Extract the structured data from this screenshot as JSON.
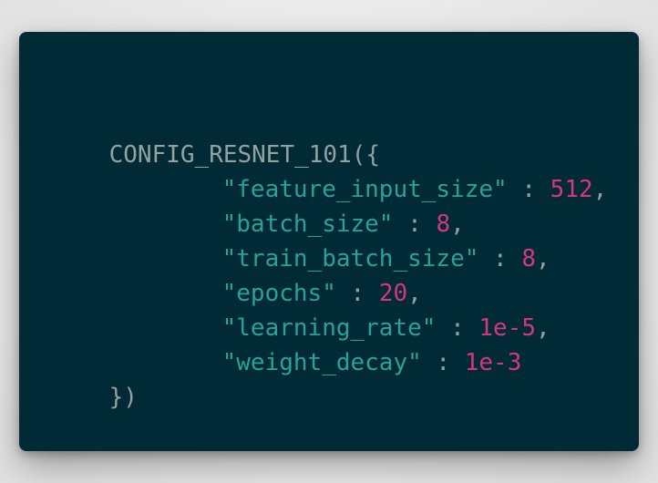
{
  "code": {
    "open_line": "CONFIG_RESNET_101({",
    "separator": " : ",
    "comma": ",",
    "close_line": "})",
    "entries": [
      {
        "key": "\"feature_input_size\"",
        "value": "512"
      },
      {
        "key": "\"batch_size\"",
        "value": "8"
      },
      {
        "key": "\"train_batch_size\"",
        "value": "8"
      },
      {
        "key": "\"epochs\"",
        "value": "20"
      },
      {
        "key": "\"learning_rate\"",
        "value": "1e-5"
      },
      {
        "key": "\"weight_decay\"",
        "value": "1e-3"
      }
    ]
  },
  "colors": {
    "background": "#002b36",
    "plain_text": "#93a1a1",
    "string": "#2aa198",
    "number": "#d33682"
  }
}
